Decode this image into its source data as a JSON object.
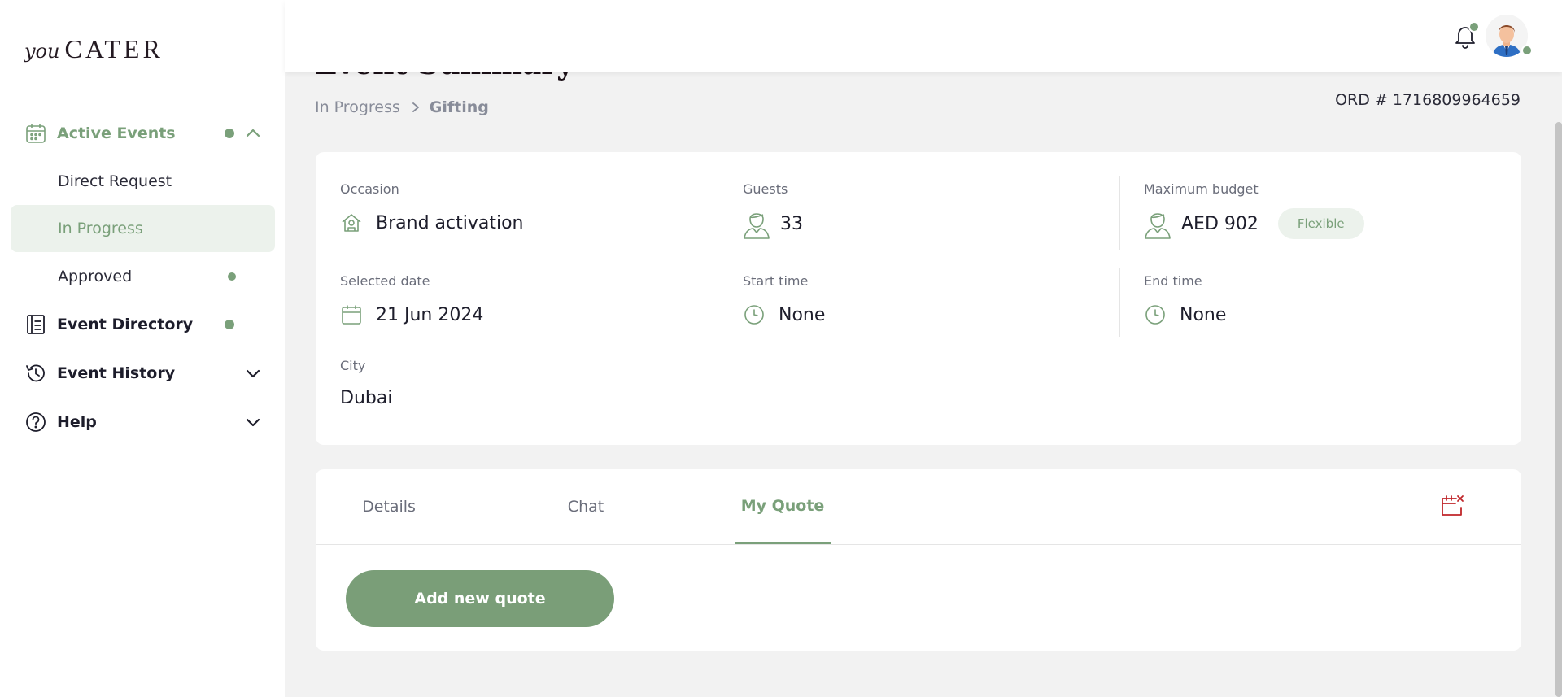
{
  "logo": {
    "you": "you",
    "cater": "CATER"
  },
  "sidebar": {
    "active_events": "Active Events",
    "direct_request": "Direct Request",
    "in_progress": "In Progress",
    "approved": "Approved",
    "event_directory": "Event Directory",
    "event_history": "Event History",
    "help": "Help"
  },
  "page": {
    "title": "Event Summary",
    "breadcrumb": {
      "parent": "In Progress",
      "current": "Gifting"
    },
    "order_number": "ORD # 1716809964659"
  },
  "summary": {
    "occasion": {
      "label": "Occasion",
      "value": "Brand activation"
    },
    "guests": {
      "label": "Guests",
      "value": "33"
    },
    "budget": {
      "label": "Maximum budget",
      "value": "AED 902",
      "badge": "Flexible"
    },
    "date": {
      "label": "Selected date",
      "value": "21 Jun 2024"
    },
    "start_time": {
      "label": "Start time",
      "value": "None"
    },
    "end_time": {
      "label": "End time",
      "value": "None"
    },
    "city": {
      "label": "City",
      "value": "Dubai"
    }
  },
  "tabs": {
    "details": "Details",
    "chat": "Chat",
    "my_quote": "My Quote",
    "active": "My Quote"
  },
  "quote": {
    "add_button": "Add new quote"
  },
  "colors": {
    "accent": "#7aa07a",
    "danger": "#c0262a"
  }
}
